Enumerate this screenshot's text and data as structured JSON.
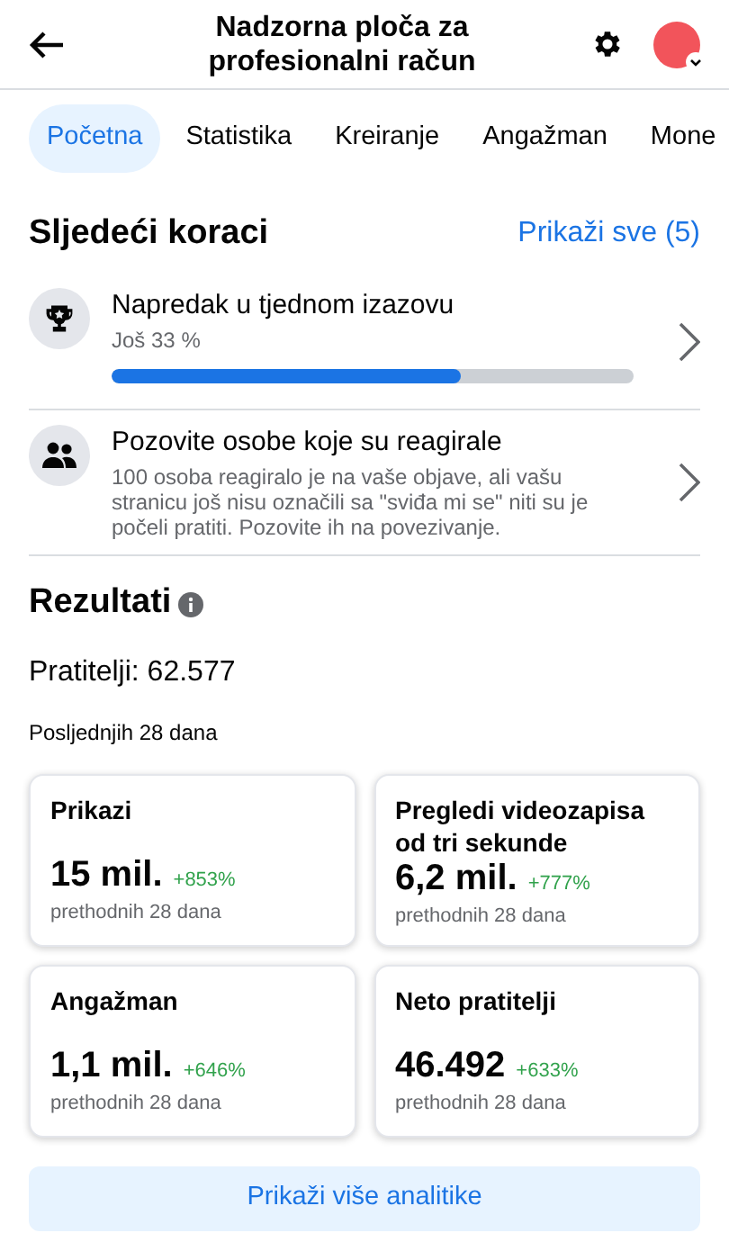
{
  "header": {
    "title": "Nadzorna ploča za profesionalni račun"
  },
  "tabs": [
    {
      "label": "Početna",
      "selected": true
    },
    {
      "label": "Statistika",
      "selected": false
    },
    {
      "label": "Kreiranje",
      "selected": false
    },
    {
      "label": "Angažman",
      "selected": false
    },
    {
      "label": "Mone",
      "selected": false
    }
  ],
  "next_steps": {
    "title": "Sljedeći koraci",
    "link": "Prikaži sve (5)",
    "items": [
      {
        "kind": "progress",
        "title": "Napredak u tjednom izazovu",
        "subtitle": "Još 33 %",
        "level": 0.67
      },
      {
        "kind": "text",
        "title": "Pozovite osobe koje su reagirale",
        "subtitle": "100 osoba reagiralo je na vaše objave, ali vašu stranicu još nisu označili sa \"sviđa mi se\" niti su je počeli pratiti. Pozovite ih na povezivanje."
      }
    ]
  },
  "results": {
    "title": "Rezultati",
    "followers": "Pratitelji: 62.577",
    "period": "Posljednjih 28 dana",
    "cards": [
      {
        "title": "Prikazi",
        "value": "15 mil.",
        "change": "+853%",
        "note": "prethodnih 28 dana"
      },
      {
        "title": "Pregledi videozapisa od tri sekunde",
        "value": "6,2 mil.",
        "change": "+777%",
        "note": "prethodnih 28 dana"
      },
      {
        "title": "Angažman",
        "value": "1,1 mil.",
        "change": "+646%",
        "note": "prethodnih 28 dana"
      },
      {
        "title": "Neto pratitelji",
        "value": "46.492",
        "change": "+633%",
        "note": "prethodnih 28 dana"
      }
    ],
    "button": "Prikaži više analitike"
  }
}
